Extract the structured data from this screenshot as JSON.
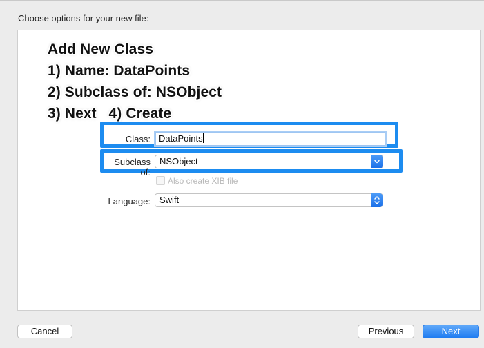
{
  "header": {
    "prompt": "Choose options for your new file:"
  },
  "instructions": {
    "lines": [
      "Add New Class",
      "1) Name: DataPoints",
      "2) Subclass of: NSObject",
      "3) Next   4) Create"
    ]
  },
  "form": {
    "class": {
      "label": "Class:",
      "value": "DataPoints"
    },
    "subclass": {
      "label": "Subclass of:",
      "value": "NSObject"
    },
    "xib": {
      "label": "Also create XIB file",
      "checked": false,
      "enabled": false
    },
    "language": {
      "label": "Language:",
      "value": "Swift"
    }
  },
  "buttons": {
    "cancel": "Cancel",
    "previous": "Previous",
    "next": "Next"
  },
  "colors": {
    "highlight": "#1d8cf0",
    "accent": "#1f7cf1"
  },
  "icons": {
    "subclass_popup": "chevron-down-icon",
    "language_popup": "up-down-chevron-icon"
  }
}
